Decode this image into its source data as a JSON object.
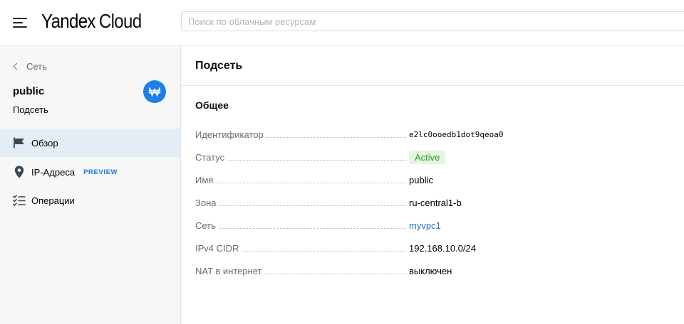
{
  "header": {
    "logo_brand": "Yandex",
    "logo_product": "Cloud",
    "search_placeholder": "Поиск по облачным ресурсам"
  },
  "sidebar": {
    "back_label": "Сеть",
    "resource_name": "public",
    "resource_type": "Подсеть",
    "items": [
      {
        "label": "Обзор",
        "icon": "flag-icon",
        "active": true
      },
      {
        "label": "IP-Адреса",
        "icon": "location-pin-icon",
        "badge": "PREVIEW"
      },
      {
        "label": "Операции",
        "icon": "checklist-icon"
      }
    ]
  },
  "main": {
    "title": "Подсеть",
    "section_title": "Общее",
    "properties": [
      {
        "key": "Идентификатор",
        "value": "e2lc0ooedb1dot9qeoa0"
      },
      {
        "key": "Статус",
        "value": "Active"
      },
      {
        "key": "Имя",
        "value": "public"
      },
      {
        "key": "Зона",
        "value": "ru-central1-b"
      },
      {
        "key": "Сеть",
        "value": "myvpc1"
      },
      {
        "key": "IPv4 CIDR",
        "value": "192.168.10.0/24"
      },
      {
        "key": "NAT в интернет",
        "value": "выключен"
      }
    ]
  },
  "colors": {
    "accent": "#1e7fe8",
    "link": "#1a73c9",
    "status_bg": "#e6f5e1",
    "status_text": "#2e9b2e",
    "active_nav_bg": "#e4edf6"
  }
}
